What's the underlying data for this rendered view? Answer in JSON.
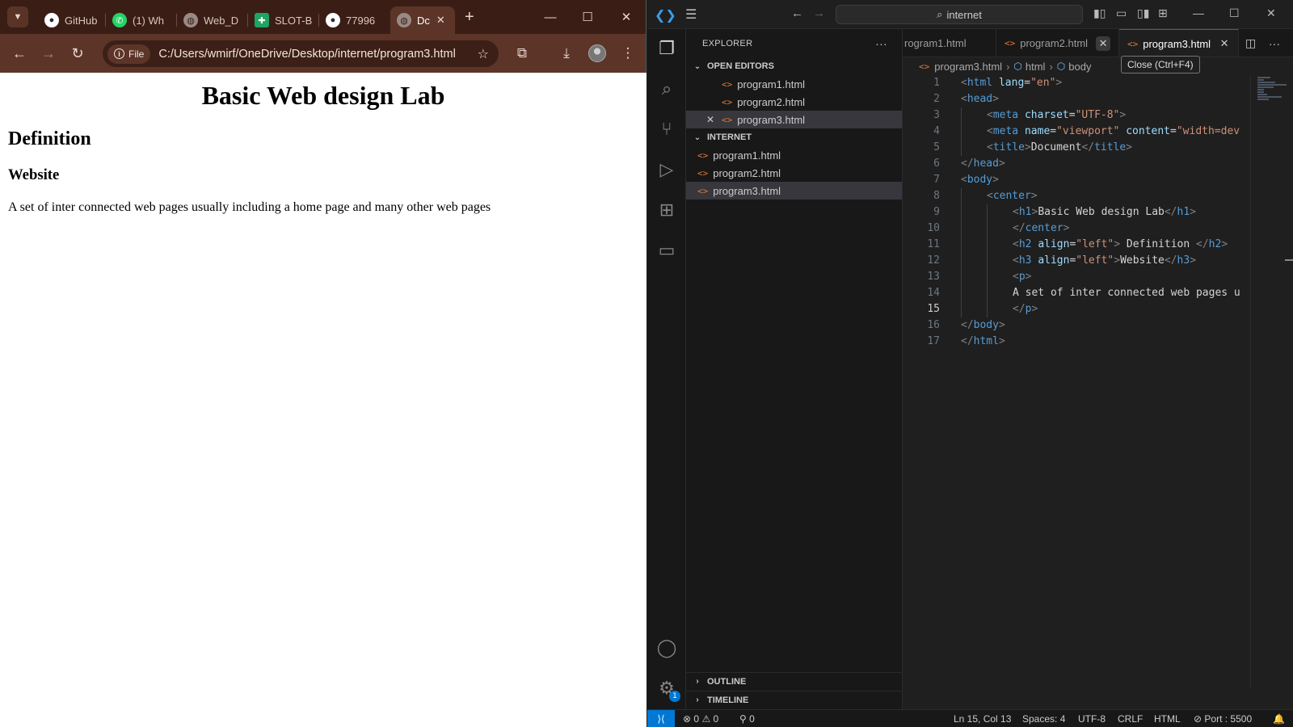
{
  "browser": {
    "tabs": [
      {
        "label": "GitHub",
        "icon": "github-icon"
      },
      {
        "label": "(1) Wh",
        "icon": "whatsapp-icon"
      },
      {
        "label": "Web_D",
        "icon": "globe-icon"
      },
      {
        "label": "SLOT-B",
        "icon": "sheets-icon"
      },
      {
        "label": "77996",
        "icon": "github-icon"
      },
      {
        "label": "Dc",
        "icon": "globe-icon"
      }
    ],
    "omnibox": {
      "chip": "File",
      "url": "C:/Users/wmirf/OneDrive/Desktop/internet/program3.html"
    },
    "page": {
      "h1": "Basic Web design Lab",
      "h2": "Definition",
      "h3": "Website",
      "p": "A set of inter connected web pages usually including a home page and many other web pages"
    }
  },
  "vscode": {
    "search": "internet",
    "explorer": {
      "title": "EXPLORER",
      "open_editors": {
        "label": "OPEN EDITORS",
        "files": [
          "program1.html",
          "program2.html",
          "program3.html"
        ]
      },
      "folder": {
        "label": "INTERNET",
        "files": [
          "program1.html",
          "program2.html",
          "program3.html"
        ]
      },
      "outline": "OUTLINE",
      "timeline": "TIMELINE"
    },
    "tabs": [
      "rogram1.html",
      "program2.html",
      "program3.html"
    ],
    "tooltip": "Close (Ctrl+F4)",
    "breadcrumbs": [
      "program3.html",
      "html",
      "body"
    ],
    "settings_badge": "1",
    "code": {
      "line_numbers": [
        "1",
        "2",
        "3",
        "4",
        "5",
        "6",
        "7",
        "8",
        "9",
        "10",
        "11",
        "12",
        "13",
        "14",
        "15",
        "16",
        "17"
      ],
      "current_line": 15
    },
    "status": {
      "errors": "0",
      "warnings": "0",
      "ports": "0",
      "position": "Ln 15, Col 13",
      "spaces": "Spaces: 4",
      "encoding": "UTF-8",
      "eol": "CRLF",
      "language": "HTML",
      "port": "Port : 5500"
    }
  },
  "colors": {
    "browser_frame": "#3a1e16",
    "browser_toolbar": "#5c3528",
    "vscode_accent": "#0078d4"
  }
}
